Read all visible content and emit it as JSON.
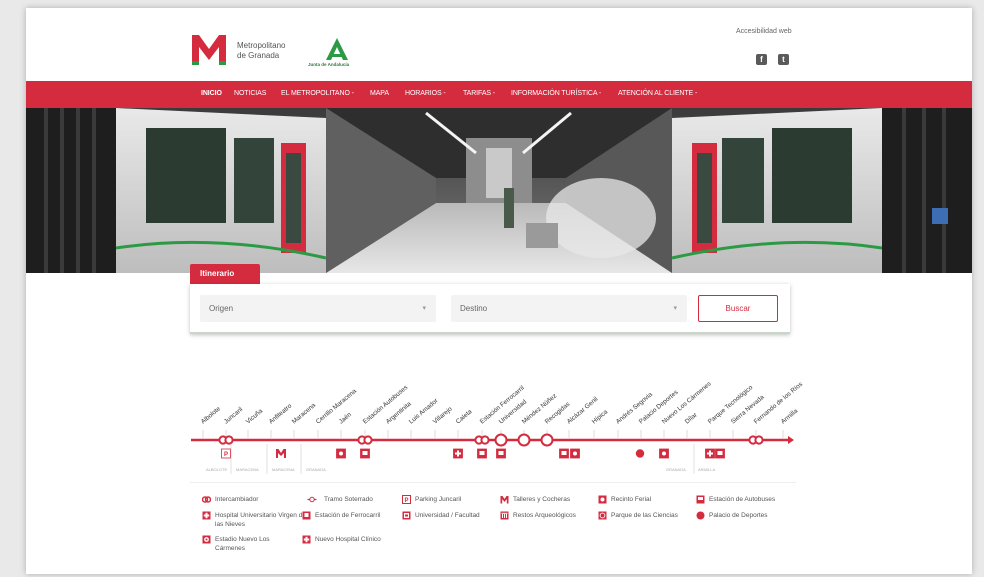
{
  "header": {
    "brand_line1": "Metropolitano",
    "brand_line2": "de Granada",
    "junta": "Junta de Andalucía",
    "accessibility": "Accesibilidad web",
    "social": [
      "facebook-icon",
      "twitter-icon"
    ]
  },
  "nav": {
    "items": [
      "INICIO",
      "NOTICIAS",
      "EL METROPOLITANO -",
      "MAPA",
      "HORARIOS -",
      "TARIFAS -",
      "INFORMACIÓN TURÍSTICA -",
      "ATENCIÓN AL CLIENTE -"
    ]
  },
  "itinerary": {
    "tab": "Itinerario",
    "origin": "Origen",
    "destination": "Destino",
    "search": "Buscar"
  },
  "stations": [
    "Albolote",
    "Juncaril",
    "Vicuña",
    "Anfiteatro",
    "Maracena",
    "Cerrillo Maracena",
    "Jaén",
    "Estación Autobuses",
    "Argentinita",
    "Luis Amador",
    "Villarejo",
    "Caleta",
    "Estación Ferrocarril",
    "Universidad",
    "Méndez Núñez",
    "Recogidas",
    "Alcázar Genil",
    "Hípica",
    "Andrés Segovia",
    "Palacio Deportes",
    "Nuevo Los Cármenes",
    "Dílar",
    "Parque Tecnológico",
    "Sierra Nevada",
    "Fernando de los Ríos",
    "Armilla"
  ],
  "zones": [
    "ALBOLOTE",
    "MARACENA",
    "MARACENA",
    "GRANADA",
    "GRANADA",
    "ARMILLA"
  ],
  "legend": [
    {
      "icon": "interchange-icon",
      "label": "Intercambiador"
    },
    {
      "icon": "underground-icon",
      "label": "Tramo Soterrado"
    },
    {
      "icon": "parking-icon",
      "label": "Parking Juncaril"
    },
    {
      "icon": "workshop-icon",
      "label": "Talleres y Cocheras"
    },
    {
      "icon": "fairground-icon",
      "label": "Recinto Ferial"
    },
    {
      "icon": "bus-station-icon",
      "label": "Estación de Autobuses"
    },
    {
      "icon": "hospital-icon",
      "label": "Hospital Universitario Virgen de las Nieves"
    },
    {
      "icon": "train-station-icon",
      "label": "Estación de Ferrocarril"
    },
    {
      "icon": "university-icon",
      "label": "Universidad / Facultad"
    },
    {
      "icon": "archaeology-icon",
      "label": "Restos Arqueológicos"
    },
    {
      "icon": "science-park-icon",
      "label": "Parque de las Ciencias"
    },
    {
      "icon": "sports-palace-icon",
      "label": "Palacio de Deportes"
    },
    {
      "icon": "stadium-icon",
      "label": "Estadio Nuevo Los Cármenes"
    },
    {
      "icon": "new-hospital-icon",
      "label": "Nuevo Hospital Clínico"
    }
  ],
  "colors": {
    "brand": "#d42b3f",
    "green": "#2c9a45"
  }
}
